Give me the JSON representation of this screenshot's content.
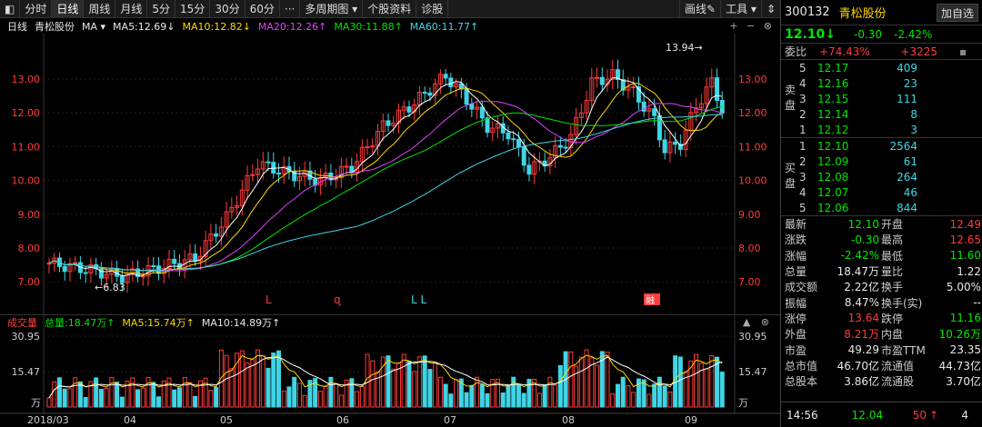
{
  "toolbar": {
    "left": [
      "分时",
      "日线",
      "周线",
      "月线",
      "5分",
      "15分",
      "30分",
      "60分",
      "···",
      "多周期图 ▾",
      "个股资料",
      "诊股"
    ],
    "right": [
      "画线✎",
      "工具 ▾"
    ]
  },
  "legend": {
    "period": "日线",
    "name": "青松股份",
    "ma": "MA ▾",
    "ma5": "MA5:12.69↓",
    "ma10": "MA10:12.82↓",
    "ma20": "MA20:12.26↑",
    "ma30": "MA30:11.88↑",
    "ma60": "MA60:11.77↑",
    "controls": "+ − ⊗"
  },
  "price_axis": [
    "13.00",
    "12.00",
    "11.00",
    "10.00",
    "9.00",
    "8.00",
    "7.00"
  ],
  "annotations": {
    "high": "13.94→",
    "low": "←6.83",
    "marker1": "L",
    "marker2": "ɋ",
    "marker3": "L L",
    "marker4": "融"
  },
  "volume": {
    "title": "成交量",
    "total": "总量:18.47万↑",
    "ma5": "MA5:15.74万↑",
    "ma10": "MA10:14.89万↑",
    "axis": [
      "30.95",
      "15.47",
      "万"
    ],
    "controls": "▲ ⊗"
  },
  "xaxis": [
    "2018/03",
    "04",
    "05",
    "06",
    "07",
    "08",
    "09"
  ],
  "colors": {
    "up": "#ff3b3b",
    "down": "#3fd5e6",
    "ma5": "#ffffff",
    "ma10": "#ffd700",
    "ma20": "#e040fb",
    "ma30": "#00e600",
    "ma60": "#3fd5e6"
  },
  "panel": {
    "code": "300132",
    "name": "青松股份",
    "add": "加自选",
    "price": "12.10↓",
    "change": "-0.30",
    "pct": "-2.42%",
    "webi_label": "委比",
    "webi_val": "+74.43%",
    "webi_diff": "+3225",
    "sell_label": "卖盘",
    "buy_label": "买盘",
    "sell": [
      {
        "lv": "5",
        "p": "12.17",
        "v": "409"
      },
      {
        "lv": "4",
        "p": "12.16",
        "v": "23"
      },
      {
        "lv": "3",
        "p": "12.15",
        "v": "111"
      },
      {
        "lv": "2",
        "p": "12.14",
        "v": "8"
      },
      {
        "lv": "1",
        "p": "12.12",
        "v": "3"
      }
    ],
    "buy": [
      {
        "lv": "1",
        "p": "12.10",
        "v": "2564"
      },
      {
        "lv": "2",
        "p": "12.09",
        "v": "61"
      },
      {
        "lv": "3",
        "p": "12.08",
        "v": "264"
      },
      {
        "lv": "4",
        "p": "12.07",
        "v": "46"
      },
      {
        "lv": "5",
        "p": "12.06",
        "v": "844"
      }
    ],
    "stats": [
      {
        "l": "最新",
        "v1": "12.10",
        "c1": "green",
        "l2": "开盘",
        "v2": "12.49",
        "c2": "red"
      },
      {
        "l": "涨跌",
        "v1": "-0.30",
        "c1": "green",
        "l2": "最高",
        "v2": "12.65",
        "c2": "red"
      },
      {
        "l": "涨幅",
        "v1": "-2.42%",
        "c1": "green",
        "l2": "最低",
        "v2": "11.60",
        "c2": "green"
      },
      {
        "l": "总量",
        "v1": "18.47万",
        "c1": "white",
        "l2": "量比",
        "v2": "1.22",
        "c2": "white"
      },
      {
        "l": "成交额",
        "v1": "2.22亿",
        "c1": "white",
        "l2": "换手",
        "v2": "5.00%",
        "c2": "white"
      },
      {
        "l": "振幅",
        "v1": "8.47%",
        "c1": "white",
        "l2": "换手(实)",
        "v2": "--",
        "c2": "white"
      },
      {
        "l": "涨停",
        "v1": "13.64",
        "c1": "red",
        "l2": "跌停",
        "v2": "11.16",
        "c2": "green"
      },
      {
        "l": "外盘",
        "v1": "8.21万",
        "c1": "red",
        "l2": "内盘",
        "v2": "10.26万",
        "c2": "green"
      },
      {
        "l": "市盈",
        "v1": "49.29",
        "c1": "white",
        "l2": "市盈TTM",
        "v2": "23.35",
        "c2": "white"
      },
      {
        "l": "总市值",
        "v1": "46.70亿",
        "c1": "white",
        "l2": "流通值",
        "v2": "44.73亿",
        "c2": "white"
      },
      {
        "l": "总股本",
        "v1": "3.86亿",
        "c1": "white",
        "l2": "流通股",
        "v2": "3.70亿",
        "c2": "white"
      }
    ],
    "tick": {
      "time": "14:56",
      "price": "12.04",
      "vol": "50",
      "arrow": "↑",
      "num": "4"
    }
  }
}
